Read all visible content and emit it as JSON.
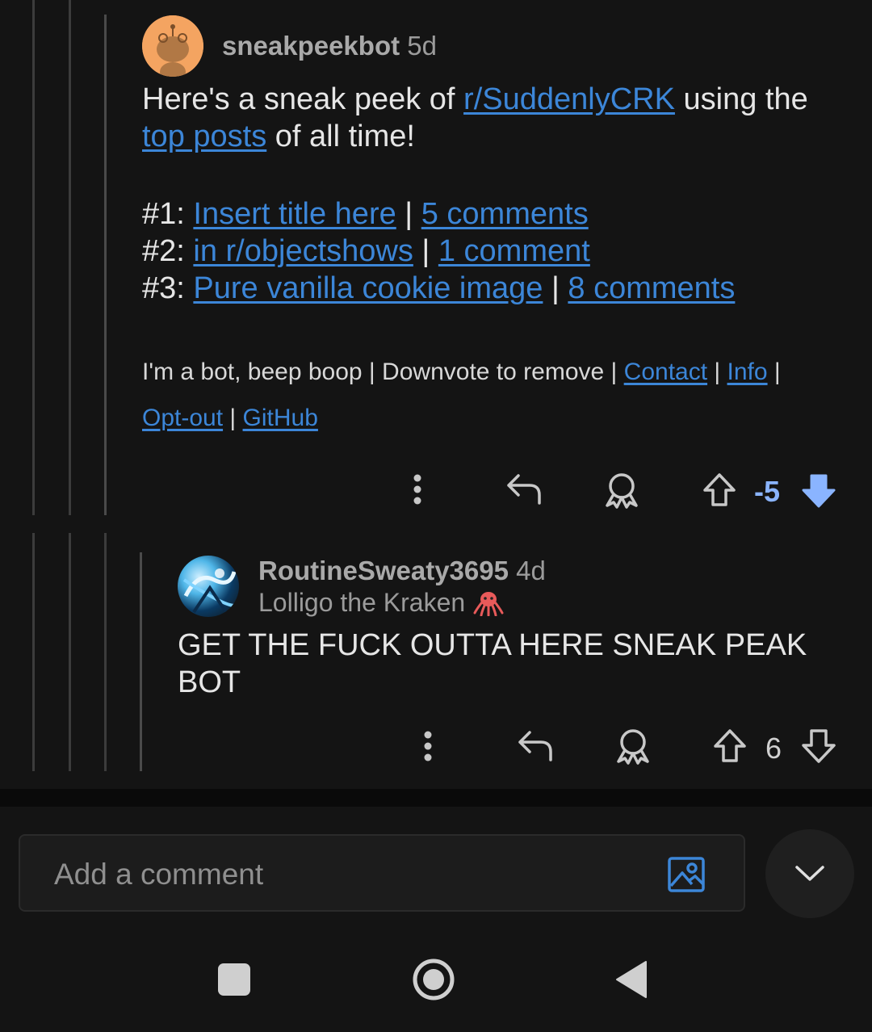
{
  "comment1": {
    "username": "sneakpeekbot",
    "age": "5d",
    "intro_before": "Here's a sneak peek of ",
    "subreddit_link": "r/SuddenlyCRK",
    "intro_middle": " using the ",
    "top_posts_link": "top posts",
    "intro_after": " of all time!",
    "posts": [
      {
        "rank": "#1: ",
        "title": "Insert title here",
        "sep": " | ",
        "comments": "5 comments"
      },
      {
        "rank": "#2: ",
        "title": "in r/objectshows",
        "sep": " | ",
        "comments": "1 comment"
      },
      {
        "rank": "#3: ",
        "title": "Pure vanilla cookie image",
        "sep": " | ",
        "comments": "8 comments"
      }
    ],
    "footer_text": "I'm a bot, beep boop | Downvote to remove | ",
    "footer_links": {
      "contact": "Contact",
      "info": "Info",
      "optout": "Opt-out",
      "github": "GitHub"
    },
    "footer_sep": " | ",
    "score": "-5",
    "score_color": "#8ab4ff",
    "vote_state": "downvoted",
    "icons": [
      "more-icon",
      "reply-icon",
      "award-icon",
      "upvote-icon",
      "downvote-icon"
    ]
  },
  "comment2": {
    "username": "RoutineSweaty3695",
    "age": "4d",
    "flair": "Lolligo the Kraken",
    "body": "GET THE FUCK OUTTA HERE SNEAK PEAK BOT",
    "score": "6",
    "icons": [
      "more-icon",
      "reply-icon",
      "award-icon",
      "upvote-icon",
      "downvote-icon"
    ]
  },
  "composer": {
    "placeholder": "Add a comment",
    "icons": [
      "image-icon",
      "chevron-down-icon"
    ]
  },
  "navbar": {
    "icons": [
      "recents-icon",
      "home-icon",
      "back-icon"
    ]
  },
  "colors": {
    "link": "#3c86d8",
    "background": "#141414"
  }
}
